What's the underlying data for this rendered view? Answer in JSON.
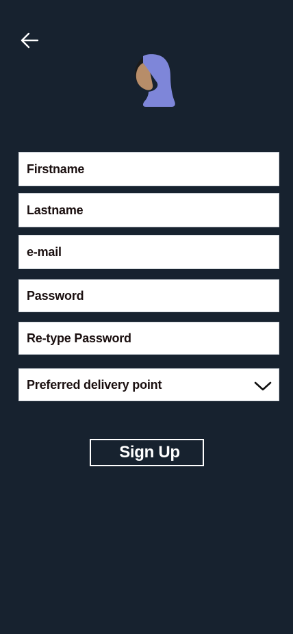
{
  "nav": {
    "back_icon": "arrow-left-icon"
  },
  "avatar": {
    "icon": "hijab-person-avatar",
    "colors": {
      "scarf": "#7e86d9",
      "skin": "#b78d69",
      "hair": "#1b1b1b"
    }
  },
  "form": {
    "firstname_placeholder": "Firstname",
    "lastname_placeholder": "Lastname",
    "email_placeholder": "e-mail",
    "password_placeholder": "Password",
    "retype_password_placeholder": "Re-type Password",
    "delivery_point_label": "Preferred delivery point",
    "delivery_point_icon": "chevron-down-icon"
  },
  "actions": {
    "signup_label": "Sign Up"
  },
  "theme": {
    "background": "#17222f",
    "field_background": "#ffffff",
    "field_text": "#1a0f0f",
    "button_border": "#ffffff"
  }
}
